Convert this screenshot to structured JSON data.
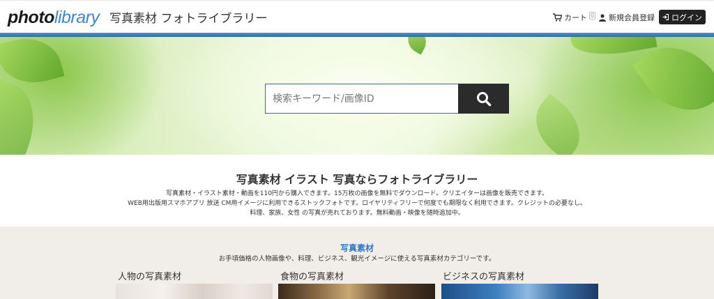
{
  "header": {
    "logo_photo": "photo",
    "logo_library": "library",
    "site_title": "写真素材 フォトライブラリー",
    "cart_label": "カート",
    "cart_count": "0",
    "register_label": "新規会員登録",
    "login_label": "ログイン"
  },
  "search": {
    "placeholder": "検索キーワード/画像ID"
  },
  "intro": {
    "heading": "写真素材 イラスト 写真ならフォトライブラリー",
    "lines": [
      "写真素材・イラスト素材・動画を110円から購入できます。15万枚の画像を無料でダウンロード。クリエイターは画像を販売できます。",
      "WEB用出版用スマホアプリ 放送 CM用イメージに利用できるストックフォトです。ロイヤリティフリーで何度でも期限なく利用できます。クレジットの必要なし。",
      "料理、家族、女性 の写真が売れております。無料動画・映像を随時追加中。"
    ]
  },
  "categories": {
    "heading": "写真素材",
    "description": "お手頃価格の人物画像や、料理、ビジネス、観光イメージに使える写真素材カテゴリーです。",
    "items": [
      {
        "title": "人物の写真素材"
      },
      {
        "title": "食物の写真素材"
      },
      {
        "title": "ビジネスの写真素材"
      }
    ]
  },
  "colors": {
    "accent": "#3f87c8",
    "header_bar": "#2f6fa8",
    "dark_button": "#2b2b2b",
    "section_bg": "#f1eee9"
  },
  "icons": [
    "cart-icon",
    "user-icon",
    "login-icon",
    "search-icon"
  ]
}
